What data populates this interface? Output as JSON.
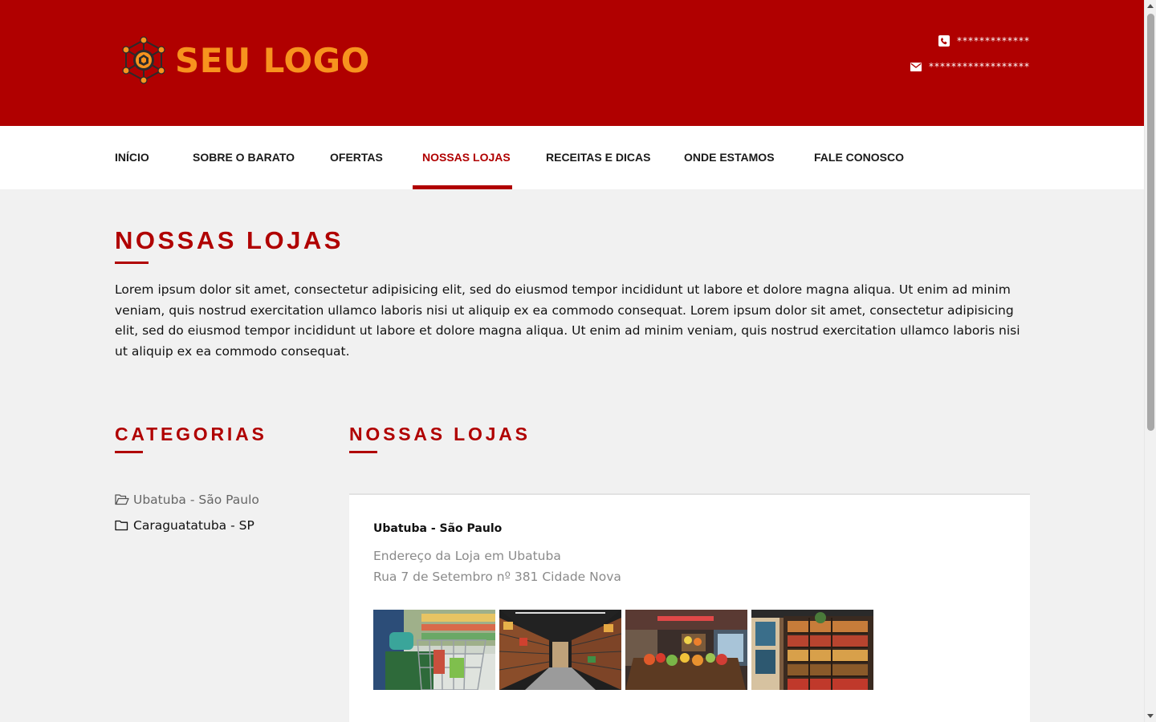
{
  "header": {
    "logo_text": "SEU LOGO",
    "phone": "*************",
    "email": "******************",
    "colors": {
      "background": "#b00000",
      "logo": "#f7931e"
    }
  },
  "nav": {
    "items": [
      {
        "label": "INÍCIO"
      },
      {
        "label": "SOBRE O BARATO"
      },
      {
        "label": "OFERTAS"
      },
      {
        "label": "NOSSAS LOJAS"
      },
      {
        "label": "RECEITAS E DICAS"
      },
      {
        "label": "ONDE ESTAMOS"
      },
      {
        "label": "FALE CONOSCO"
      }
    ],
    "active": "NOSSAS LOJAS"
  },
  "main": {
    "title": "NOSSAS LOJAS",
    "intro": "Lorem ipsum dolor sit amet, consectetur adipisicing elit, sed do eiusmod tempor incididunt ut labore et dolore magna aliqua. Ut enim ad minim veniam, quis nostrud exercitation ullamco laboris nisi ut aliquip ex ea commodo consequat. Lorem ipsum dolor sit amet, consectetur adipisicing elit, sed do eiusmod tempor incididunt ut labore et dolore magna aliqua. Ut enim ad minim veniam, quis nostrud exercitation ullamco laboris nisi ut aliquip ex ea commodo consequat."
  },
  "sidebar": {
    "title": "CATEGORIAS",
    "items": [
      {
        "label": "Ubatuba - São Paulo",
        "icon": "folder-open-icon"
      },
      {
        "label": "Caraguatatuba - SP",
        "icon": "folder-icon"
      }
    ]
  },
  "stores": {
    "title": "NOSSAS LOJAS",
    "store": {
      "name": "Ubatuba - São Paulo",
      "address_line1": "Endereço da Loja em Ubatuba",
      "address_line2": "Rua 7 de Setembro nº 381 Cidade Nova",
      "photos": [
        "shopping-cart-photo",
        "supermarket-aisle-photo",
        "produce-section-photo",
        "grocery-shelves-photo"
      ]
    }
  }
}
